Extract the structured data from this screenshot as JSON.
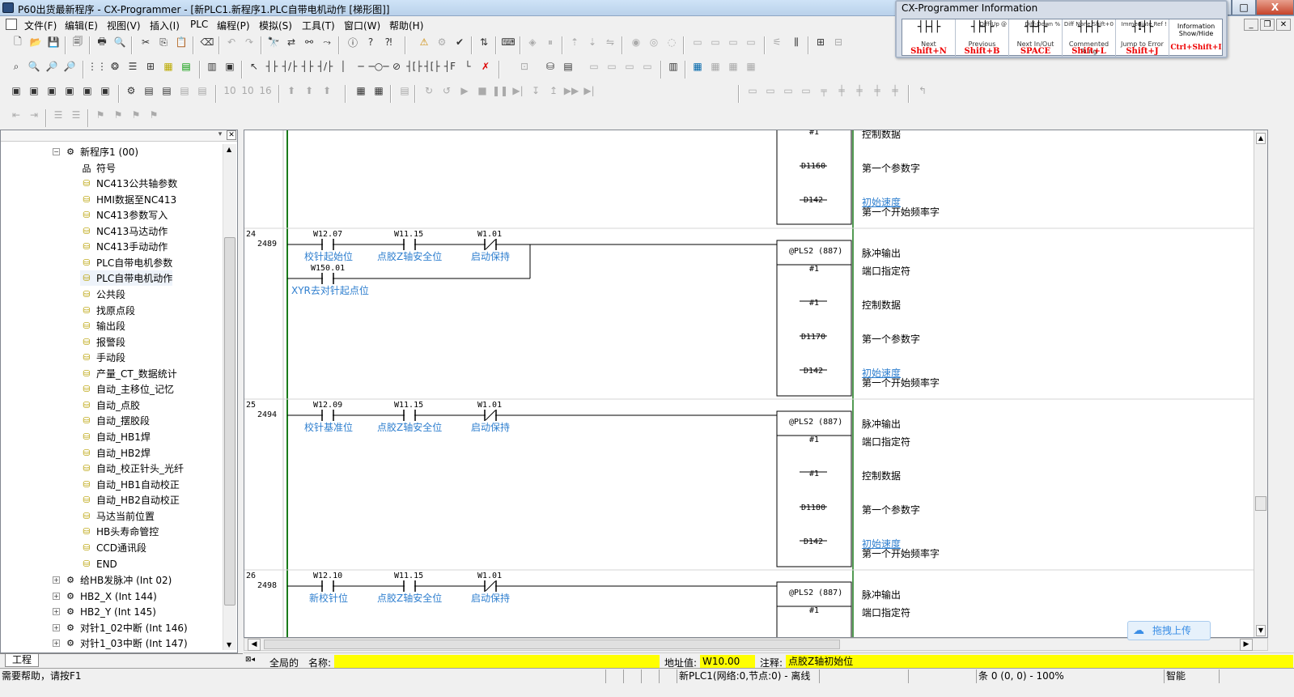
{
  "window": {
    "title": "P60出货最新程序 - CX-Programmer - [新PLC1.新程序1.PLC自带电机动作 [梯形图]]",
    "controls": [
      "_",
      "□",
      "X"
    ]
  },
  "menu": {
    "items": [
      "文件(F)",
      "编辑(E)",
      "视图(V)",
      "插入(I)",
      "PLC",
      "编程(P)",
      "模拟(S)",
      "工具(T)",
      "窗口(W)",
      "帮助(H)"
    ]
  },
  "info_panel": {
    "title": "CX-Programmer Information",
    "cells": [
      {
        "icon": "┤├┤├",
        "small": "",
        "cap": "Next",
        "key": "Shift+N"
      },
      {
        "icon": "┤├┤├",
        "small": "Diff-Up @",
        "cap": "Previous",
        "key": "Shift+B"
      },
      {
        "icon": "┤┼┤├",
        "small": "Diff-Down %",
        "cap": "Next In/Out",
        "key": "SPACE"
      },
      {
        "icon": "┤├┤├",
        "small": "Diff None Shift+0",
        "cap": "Commented Rung",
        "key": "Shift+L"
      },
      {
        "icon": "┤!┤├",
        "small": "Immediate Ref !",
        "cap": "Jump to Error",
        "key": "Shift+J"
      },
      {
        "icon": "Information Show/Hide",
        "small": "",
        "cap": "",
        "key": "Ctrl+Shift+I"
      }
    ]
  },
  "project_tree": {
    "tab_label": "工程",
    "program": "新程序1 (00)",
    "sections": [
      "符号",
      "NC413公共轴参数",
      "HMI数据至NC413",
      "NC413参数写入",
      "NC413马达动作",
      "NC413手动动作",
      "PLC自带电机参数",
      "PLC自带电机动作",
      "公共段",
      "找原点段",
      "输出段",
      "报警段",
      "手动段",
      "产量_CT_数据统计",
      "自动_主移位_记忆",
      "自动_点胶",
      "自动_摆胶段",
      "自动_HB1焊",
      "自动_HB2焊",
      "自动_校正针头_光纤",
      "自动_HB1自动校正",
      "自动_HB2自动校正",
      "马达当前位置",
      "HB头寿命管控",
      "CCD通讯段",
      "END"
    ],
    "interrupts": [
      "给HB发脉冲 (Int 02)",
      "HB2_X (Int 144)",
      "HB2_Y (Int 145)",
      "对针1_02中断 (Int 146)",
      "对针1_03中断 (Int 147)"
    ]
  },
  "ladder": {
    "partial_top": {
      "operands": [
        "#1",
        "D1160",
        "D142"
      ],
      "comments": [
        "控制数据",
        "第一个参数字",
        "初始速度",
        "第一个开始频率字"
      ]
    },
    "rungs": [
      {
        "rung": "24",
        "step": "2489",
        "contacts": [
          {
            "addr": "W12.07",
            "cmt": "校针起始位",
            "type": "NO"
          },
          {
            "addr": "W11.15",
            "cmt": "点胶Z轴安全位",
            "type": "NO"
          },
          {
            "addr": "W1.01",
            "cmt": "启动保持",
            "type": "NC"
          }
        ],
        "branch": {
          "addr": "W150.01",
          "cmt": "XYR去对针起点位"
        },
        "instr": "@PLS2 (887)",
        "operands": [
          "#1",
          "#1",
          "D1170",
          "D142"
        ],
        "comments": [
          "脉冲输出",
          "端口指定符",
          "控制数据",
          "第一个参数字",
          "初始速度",
          "第一个开始频率字"
        ]
      },
      {
        "rung": "25",
        "step": "2494",
        "contacts": [
          {
            "addr": "W12.09",
            "cmt": "校针基准位",
            "type": "NO"
          },
          {
            "addr": "W11.15",
            "cmt": "点胶Z轴安全位",
            "type": "NO"
          },
          {
            "addr": "W1.01",
            "cmt": "启动保持",
            "type": "NC"
          }
        ],
        "instr": "@PLS2 (887)",
        "operands": [
          "#1",
          "#1",
          "D1180",
          "D142"
        ],
        "comments": [
          "脉冲输出",
          "端口指定符",
          "控制数据",
          "第一个参数字",
          "初始速度",
          "第一个开始频率字"
        ]
      },
      {
        "rung": "26",
        "step": "2498",
        "contacts": [
          {
            "addr": "W12.10",
            "cmt": "新校针位",
            "type": "NO"
          },
          {
            "addr": "W11.15",
            "cmt": "点胶Z轴安全位",
            "type": "NO"
          },
          {
            "addr": "W1.01",
            "cmt": "启动保持",
            "type": "NC"
          }
        ],
        "instr": "@PLS2 (887)",
        "operands": [
          "#1"
        ],
        "comments": [
          "脉冲输出",
          "端口指定符"
        ]
      }
    ]
  },
  "baidu_button": "拖拽上传",
  "info_bar": {
    "scope": "全局的",
    "name_label": "名称:",
    "name_value": "",
    "addr_label": "地址值:",
    "addr_value": "W10.00",
    "comment_label": "注释:",
    "comment_value": "点胶Z轴初始位"
  },
  "status_bar": {
    "help": "需要帮助，请按F1",
    "plc": "新PLC1(网络:0,节点:0) - 离线",
    "position": "条 0 (0, 0)  - 100%",
    "mode": "智能"
  },
  "colors": {
    "comment_blue": "#2f7fcf",
    "highlight_yellow": "#ffff00",
    "power_rail": "#1a7a1a",
    "titlebar": "#c6dbf2"
  }
}
